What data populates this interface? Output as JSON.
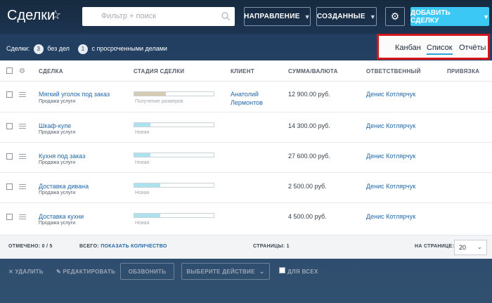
{
  "header": {
    "title": "Сделки",
    "star_icon": "star-icon",
    "search_placeholder": "Фильтр + поиск",
    "direction_label": "НАПРАВЛЕНИЕ",
    "created_label": "СОЗДАННЫЕ",
    "add_deal_label": "ДОБАВИТЬ СДЕЛКУ",
    "accent_color": "#3bc8f5"
  },
  "summary": {
    "deals_label": "Сделки:",
    "no_tasks_count": "3",
    "no_tasks_label": "без дел",
    "overdue_count": "1",
    "overdue_label": "с просроченными делами"
  },
  "views": {
    "kanban": "Канбан",
    "list": "Список",
    "reports": "Отчёты",
    "active": "list",
    "highlight_color": "#d4151c"
  },
  "columns": {
    "deal": "СДЕЛКА",
    "stage": "СТАДИЯ СДЕЛКИ",
    "client": "КЛИЕНТ",
    "sum": "СУММА/ВАЛЮТА",
    "responsible": "ОТВЕТСТВЕННЫЙ",
    "binding": "ПРИВЯЗКА"
  },
  "rows": [
    {
      "deal": "Мягкий уголок под заказ",
      "type": "Продажа услуги",
      "stage": "Получение размеров",
      "stage_progress": 0.4,
      "stage_color": "#d6cbb2",
      "client": "Анатолий Лермонтов",
      "sum": "12 900.00 руб.",
      "responsible": "Денис Котлярчук"
    },
    {
      "deal": "Шкаф-купе",
      "type": "Продажа услуги",
      "stage": "Новая",
      "stage_progress": 0.2,
      "stage_color": "#aee1ee",
      "client": "",
      "sum": "14 300.00 руб.",
      "responsible": "Денис Котлярчук"
    },
    {
      "deal": "Кухня под заказ",
      "type": "Продажа услуги",
      "stage": "Новая",
      "stage_progress": 0.2,
      "stage_color": "#aee1ee",
      "client": "",
      "sum": "27 600.00 руб.",
      "responsible": "Денис Котлярчук"
    },
    {
      "deal": "Доставка дивана",
      "type": "Продажа услуги",
      "stage": "Новая",
      "stage_progress": 0.33,
      "stage_color": "#aee1ee",
      "client": "",
      "sum": "2 500.00 руб.",
      "responsible": "Денис Котлярчук"
    },
    {
      "deal": "Доставка кухни",
      "type": "Продажа услуги",
      "stage": "Новая",
      "stage_progress": 0.33,
      "stage_color": "#aee1ee",
      "client": "",
      "sum": "4 500.00 руб.",
      "responsible": "Денис Котлярчук"
    }
  ],
  "footer": {
    "selected": "ОТМЕЧЕНО: 0 / 5",
    "total_label": "ВСЕГО:",
    "show_count": "ПОКАЗАТЬ КОЛИЧЕСТВО",
    "pages": "СТРАНИЦЫ: 1",
    "per_page_label": "НА СТРАНИЦЕ:",
    "per_page_value": "20"
  },
  "actions": {
    "delete": "УДАЛИТЬ",
    "edit": "РЕДАКТИРОВАТЬ",
    "call": "ОБЗВОНИТЬ",
    "choose_action": "ВЫБЕРИТЕ ДЕЙСТВИЕ",
    "for_all": "ДЛЯ ВСЕХ"
  }
}
